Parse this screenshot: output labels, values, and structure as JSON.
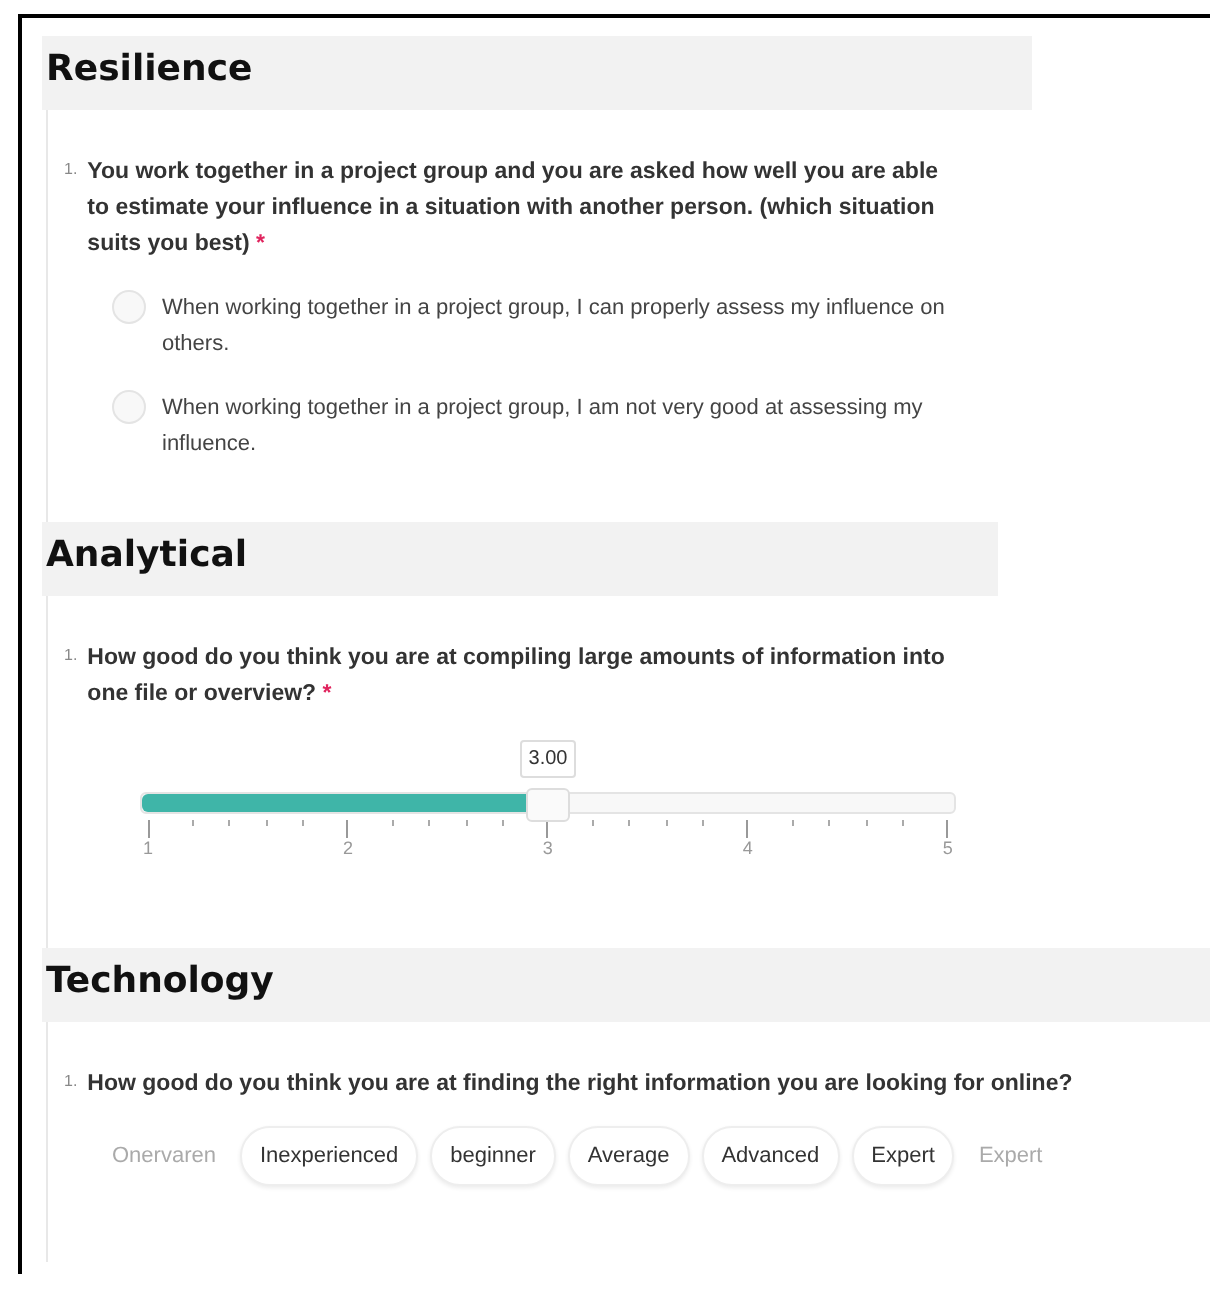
{
  "sections": [
    {
      "title": "Resilience",
      "question": {
        "number": "1.",
        "text": "You work together in a project group and you are asked how well you are able to estimate your influence in a situation with another person. (which situation suits you best)",
        "required_mark": "*",
        "kind": "radio",
        "options": [
          {
            "label": "When working together in a project group, I can properly assess my influence on others.",
            "selected": false
          },
          {
            "label": "When working together in a project group, I am not very good at assessing my influence.",
            "selected": false
          }
        ]
      }
    },
    {
      "title": "Analytical",
      "question": {
        "number": "1.",
        "text": "How good do you think you are at compiling large amounts of information into one file or overview?",
        "required_mark": "*",
        "kind": "slider",
        "value": "3.00",
        "level": 0.5,
        "tick_labels": [
          "1",
          "2",
          "3",
          "4",
          "5"
        ]
      }
    },
    {
      "title": "Technology",
      "question": {
        "number": "1.",
        "text": "How good do you think you are at finding the right information you are looking for online?",
        "kind": "chips",
        "low_label": "Onervaren",
        "high_label": "Expert",
        "chips": [
          {
            "label": "Inexperienced",
            "selected": false
          },
          {
            "label": "beginner",
            "selected": false
          },
          {
            "label": "Average",
            "selected": false
          },
          {
            "label": "Advanced",
            "selected": false
          },
          {
            "label": "Expert",
            "selected": false
          }
        ]
      }
    }
  ]
}
